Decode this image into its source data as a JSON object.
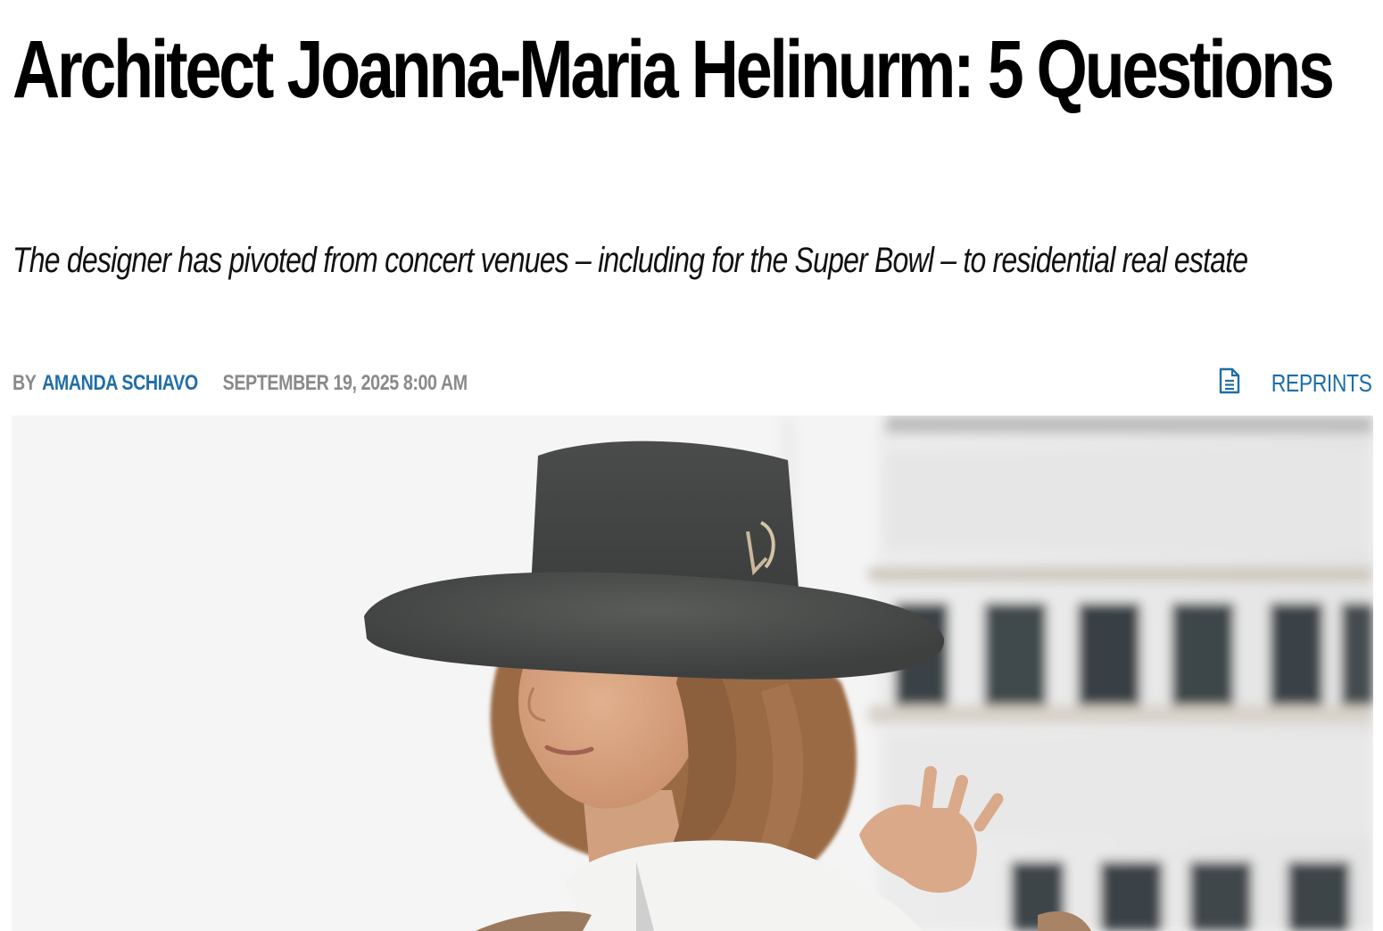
{
  "article": {
    "headline": "Architect Joanna-Maria Helinurm: 5 Questions",
    "dek": "The designer has pivoted from concert venues – including for the Super Bowl – to residential real estate"
  },
  "byline": {
    "by": "BY",
    "author": "AMANDA SCHIAVO",
    "date": "SEPTEMBER 19, 2025 8:00 AM"
  },
  "reprints": {
    "label": "REPRINTS",
    "icon": "document-icon"
  },
  "colors": {
    "link": "#1f6ea6",
    "meta_gray": "#8a8a8a",
    "headline": "#000000"
  }
}
